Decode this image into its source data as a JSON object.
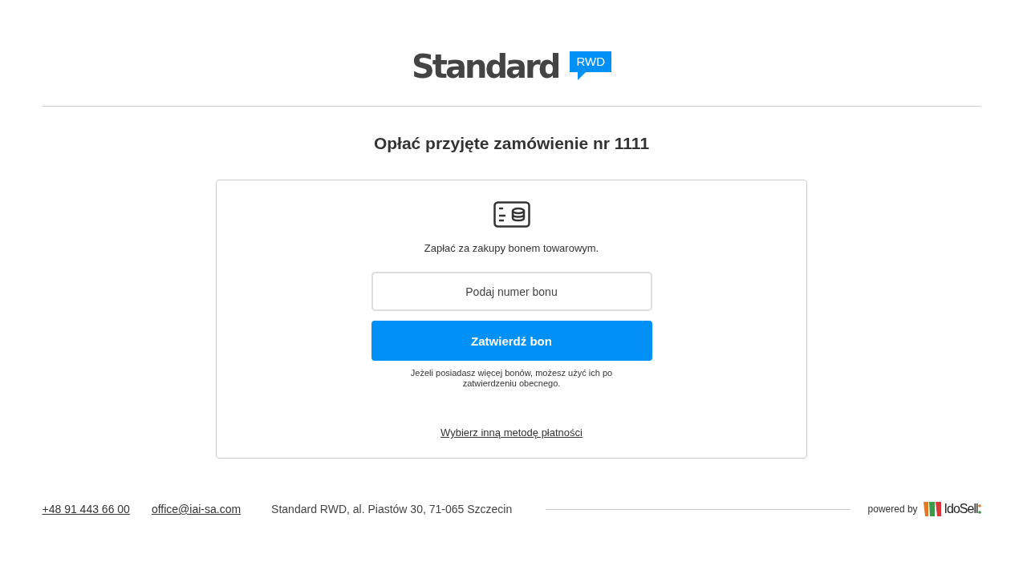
{
  "logo": {
    "name": "Standard",
    "badge": "RWD"
  },
  "title": "Opłać przyjęte zamówienie nr 1111",
  "voucher": {
    "description": "Zapłać za zakupy bonem towarowym.",
    "placeholder": "Podaj numer bonu",
    "submit": "Zatwierdź bon",
    "note": "Jeżeli posiadasz więcej bonów, możesz użyć ich po zatwierdzeniu obecnego.",
    "other_method": "Wybierz inną metodę płatności"
  },
  "footer": {
    "phone": "+48 91 443 66 00",
    "email": "office@iai-sa.com",
    "address": "Standard RWD, al. Piastów 30, 71-065 Szczecin",
    "powered_by": "powered by",
    "brand": "IdoSell"
  }
}
